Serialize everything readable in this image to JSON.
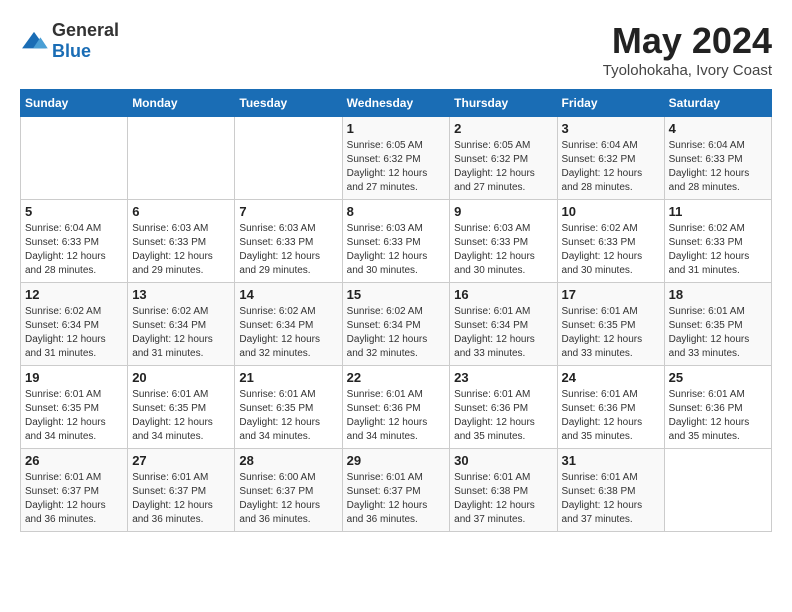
{
  "logo": {
    "general": "General",
    "blue": "Blue"
  },
  "title": "May 2024",
  "subtitle": "Tyolohokaha, Ivory Coast",
  "days_header": [
    "Sunday",
    "Monday",
    "Tuesday",
    "Wednesday",
    "Thursday",
    "Friday",
    "Saturday"
  ],
  "weeks": [
    [
      {
        "day": "",
        "sunrise": "",
        "sunset": "",
        "daylight": ""
      },
      {
        "day": "",
        "sunrise": "",
        "sunset": "",
        "daylight": ""
      },
      {
        "day": "",
        "sunrise": "",
        "sunset": "",
        "daylight": ""
      },
      {
        "day": "1",
        "sunrise": "Sunrise: 6:05 AM",
        "sunset": "Sunset: 6:32 PM",
        "daylight": "Daylight: 12 hours and 27 minutes."
      },
      {
        "day": "2",
        "sunrise": "Sunrise: 6:05 AM",
        "sunset": "Sunset: 6:32 PM",
        "daylight": "Daylight: 12 hours and 27 minutes."
      },
      {
        "day": "3",
        "sunrise": "Sunrise: 6:04 AM",
        "sunset": "Sunset: 6:32 PM",
        "daylight": "Daylight: 12 hours and 28 minutes."
      },
      {
        "day": "4",
        "sunrise": "Sunrise: 6:04 AM",
        "sunset": "Sunset: 6:33 PM",
        "daylight": "Daylight: 12 hours and 28 minutes."
      }
    ],
    [
      {
        "day": "5",
        "sunrise": "Sunrise: 6:04 AM",
        "sunset": "Sunset: 6:33 PM",
        "daylight": "Daylight: 12 hours and 28 minutes."
      },
      {
        "day": "6",
        "sunrise": "Sunrise: 6:03 AM",
        "sunset": "Sunset: 6:33 PM",
        "daylight": "Daylight: 12 hours and 29 minutes."
      },
      {
        "day": "7",
        "sunrise": "Sunrise: 6:03 AM",
        "sunset": "Sunset: 6:33 PM",
        "daylight": "Daylight: 12 hours and 29 minutes."
      },
      {
        "day": "8",
        "sunrise": "Sunrise: 6:03 AM",
        "sunset": "Sunset: 6:33 PM",
        "daylight": "Daylight: 12 hours and 30 minutes."
      },
      {
        "day": "9",
        "sunrise": "Sunrise: 6:03 AM",
        "sunset": "Sunset: 6:33 PM",
        "daylight": "Daylight: 12 hours and 30 minutes."
      },
      {
        "day": "10",
        "sunrise": "Sunrise: 6:02 AM",
        "sunset": "Sunset: 6:33 PM",
        "daylight": "Daylight: 12 hours and 30 minutes."
      },
      {
        "day": "11",
        "sunrise": "Sunrise: 6:02 AM",
        "sunset": "Sunset: 6:33 PM",
        "daylight": "Daylight: 12 hours and 31 minutes."
      }
    ],
    [
      {
        "day": "12",
        "sunrise": "Sunrise: 6:02 AM",
        "sunset": "Sunset: 6:34 PM",
        "daylight": "Daylight: 12 hours and 31 minutes."
      },
      {
        "day": "13",
        "sunrise": "Sunrise: 6:02 AM",
        "sunset": "Sunset: 6:34 PM",
        "daylight": "Daylight: 12 hours and 31 minutes."
      },
      {
        "day": "14",
        "sunrise": "Sunrise: 6:02 AM",
        "sunset": "Sunset: 6:34 PM",
        "daylight": "Daylight: 12 hours and 32 minutes."
      },
      {
        "day": "15",
        "sunrise": "Sunrise: 6:02 AM",
        "sunset": "Sunset: 6:34 PM",
        "daylight": "Daylight: 12 hours and 32 minutes."
      },
      {
        "day": "16",
        "sunrise": "Sunrise: 6:01 AM",
        "sunset": "Sunset: 6:34 PM",
        "daylight": "Daylight: 12 hours and 33 minutes."
      },
      {
        "day": "17",
        "sunrise": "Sunrise: 6:01 AM",
        "sunset": "Sunset: 6:35 PM",
        "daylight": "Daylight: 12 hours and 33 minutes."
      },
      {
        "day": "18",
        "sunrise": "Sunrise: 6:01 AM",
        "sunset": "Sunset: 6:35 PM",
        "daylight": "Daylight: 12 hours and 33 minutes."
      }
    ],
    [
      {
        "day": "19",
        "sunrise": "Sunrise: 6:01 AM",
        "sunset": "Sunset: 6:35 PM",
        "daylight": "Daylight: 12 hours and 34 minutes."
      },
      {
        "day": "20",
        "sunrise": "Sunrise: 6:01 AM",
        "sunset": "Sunset: 6:35 PM",
        "daylight": "Daylight: 12 hours and 34 minutes."
      },
      {
        "day": "21",
        "sunrise": "Sunrise: 6:01 AM",
        "sunset": "Sunset: 6:35 PM",
        "daylight": "Daylight: 12 hours and 34 minutes."
      },
      {
        "day": "22",
        "sunrise": "Sunrise: 6:01 AM",
        "sunset": "Sunset: 6:36 PM",
        "daylight": "Daylight: 12 hours and 34 minutes."
      },
      {
        "day": "23",
        "sunrise": "Sunrise: 6:01 AM",
        "sunset": "Sunset: 6:36 PM",
        "daylight": "Daylight: 12 hours and 35 minutes."
      },
      {
        "day": "24",
        "sunrise": "Sunrise: 6:01 AM",
        "sunset": "Sunset: 6:36 PM",
        "daylight": "Daylight: 12 hours and 35 minutes."
      },
      {
        "day": "25",
        "sunrise": "Sunrise: 6:01 AM",
        "sunset": "Sunset: 6:36 PM",
        "daylight": "Daylight: 12 hours and 35 minutes."
      }
    ],
    [
      {
        "day": "26",
        "sunrise": "Sunrise: 6:01 AM",
        "sunset": "Sunset: 6:37 PM",
        "daylight": "Daylight: 12 hours and 36 minutes."
      },
      {
        "day": "27",
        "sunrise": "Sunrise: 6:01 AM",
        "sunset": "Sunset: 6:37 PM",
        "daylight": "Daylight: 12 hours and 36 minutes."
      },
      {
        "day": "28",
        "sunrise": "Sunrise: 6:00 AM",
        "sunset": "Sunset: 6:37 PM",
        "daylight": "Daylight: 12 hours and 36 minutes."
      },
      {
        "day": "29",
        "sunrise": "Sunrise: 6:01 AM",
        "sunset": "Sunset: 6:37 PM",
        "daylight": "Daylight: 12 hours and 36 minutes."
      },
      {
        "day": "30",
        "sunrise": "Sunrise: 6:01 AM",
        "sunset": "Sunset: 6:38 PM",
        "daylight": "Daylight: 12 hours and 37 minutes."
      },
      {
        "day": "31",
        "sunrise": "Sunrise: 6:01 AM",
        "sunset": "Sunset: 6:38 PM",
        "daylight": "Daylight: 12 hours and 37 minutes."
      },
      {
        "day": "",
        "sunrise": "",
        "sunset": "",
        "daylight": ""
      }
    ]
  ]
}
